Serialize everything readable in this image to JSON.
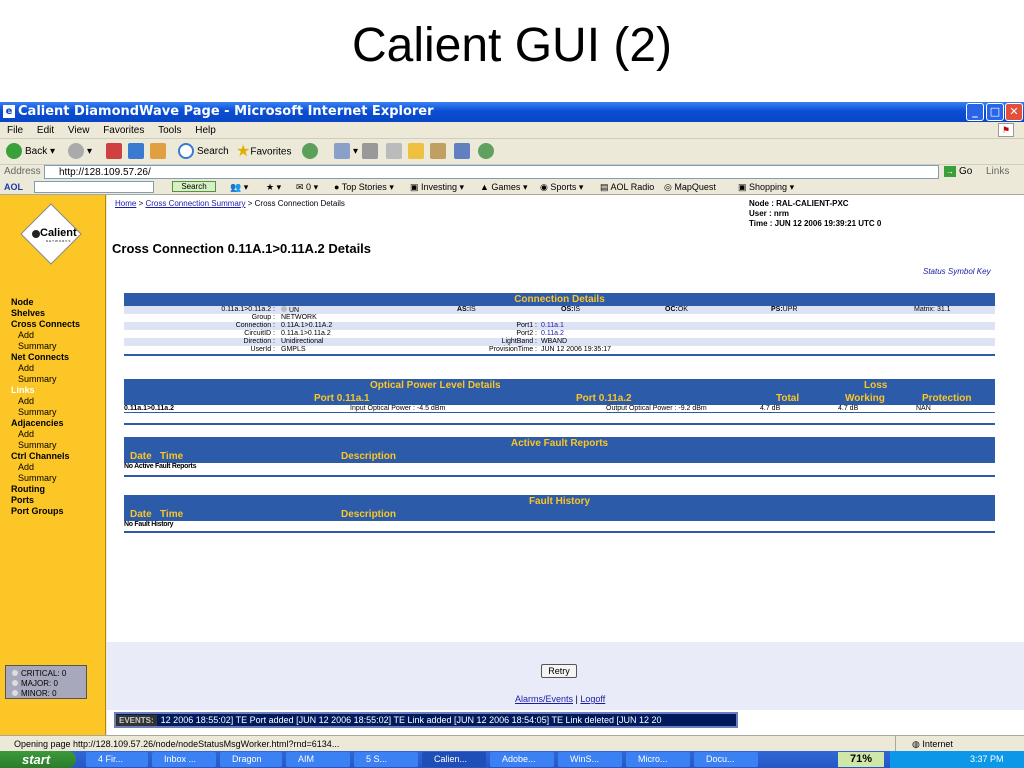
{
  "slide_title": "Calient GUI (2)",
  "window": {
    "title": "Calient DiamondWave Page - Microsoft Internet Explorer",
    "minimize": "_",
    "maximize": "□",
    "close": "✕"
  },
  "menu": [
    "File",
    "Edit",
    "View",
    "Favorites",
    "Tools",
    "Help"
  ],
  "toolbar": {
    "back": "Back",
    "search": "Search",
    "favorites": "Favorites"
  },
  "address": {
    "label": "Address",
    "url": "http://128.109.57.26/",
    "go": "Go",
    "links": "Links"
  },
  "aol": {
    "label": "AOL",
    "search_button": "Search",
    "mail_count": "0",
    "items": [
      "Top Stories",
      "Investing",
      "Games",
      "Sports",
      "AOL Radio",
      "MapQuest",
      "Shopping"
    ]
  },
  "sidebar": {
    "logo": "Calient",
    "logo_sub": "NETWORKS",
    "legend": [
      "CRITICAL: 0",
      "MAJOR: 0",
      "MINOR: 0"
    ]
  },
  "breadcrumb": {
    "home": "Home",
    "sep1": " > ",
    "summary": "Cross Connection Summary",
    "current": " > Cross Connection Details"
  },
  "node_info": {
    "node": "Node : RAL-CALIENT-PXC",
    "user": "User : nrm",
    "time": "Time : JUN 12 2006 19:39:21 UTC 0"
  },
  "page_title": "Cross Connection 0.11A.1>0.11A.2 Details",
  "status_symbol_key": "Status Symbol Key",
  "connection_details": {
    "header": "Connection Details",
    "name": "0.11a.1>0.11a.2 :",
    "name_status": "UN",
    "as_label": "AS:",
    "as_value": "IS",
    "os_label": "OS:",
    "os_value": "IS",
    "oc_label": "OC:",
    "oc_value": "OK",
    "ps_label": "PS:",
    "ps_value": "UPR",
    "matrix_label": "Matrix:",
    "matrix_value": "31.1",
    "group_label": "Group :",
    "group_value": "NETWORK",
    "connection_label": "Connection :",
    "connection_value": "0.11A.1>0.11A.2",
    "circuitid_label": "CircuitID :",
    "circuitid_value": "0.11a.1>0.11a.2",
    "direction_label": "Direction :",
    "direction_value": "Unidirectional",
    "userid_label": "UserId :",
    "userid_value": "GMPLS",
    "port1_label": "Port1 :",
    "port1_value": "0.11a.1",
    "port2_label": "Port2 :",
    "port2_value": "0.11a.2",
    "lightband_label": "LightBand :",
    "lightband_value": "WBAND",
    "provision_label": "ProvisionTime :",
    "provision_value": "JUN 12 2006 19:35:17"
  },
  "optical_power": {
    "header": "Optical Power Level Details",
    "loss": "Loss",
    "col_port1": "Port 0.11a.1",
    "col_port2": "Port 0.11a.2",
    "col_total": "Total",
    "col_working": "Working",
    "col_protection": "Protection",
    "row_name": "0.11a.1>0.11a.2",
    "input": "Input Optical Power : -4.5 dBm",
    "output": "Output Optical Power : -9.2 dBm",
    "total": "4.7 dB",
    "working": "4.7 dB",
    "protection": "NAN"
  },
  "active_faults": {
    "header": "Active Fault Reports",
    "col_date": "Date",
    "col_time": "Time",
    "col_desc": "Description",
    "empty": "No Active Fault Reports"
  },
  "fault_history": {
    "header": "Fault History",
    "col_date": "Date",
    "col_time": "Time",
    "col_desc": "Description",
    "empty": "No Fault History"
  },
  "retry": "Retry",
  "footer_links": {
    "alarms": "Alarms/Events",
    "sep": " | ",
    "logoff": "Logoff"
  },
  "events": {
    "label": "EVENTS:",
    "text": "12 2006 18:55:02] TE Port added    [JUN 12 2006 18:55:02] TE Link added    [JUN 12 2006 18:54:05] TE Link deleted    [JUN 12 20"
  },
  "status_bar": {
    "text": "Opening page http://128.109.57.26/node/nodeStatusMsgWorker.html?rnd=6134...",
    "zone": "Internet"
  },
  "taskbar": {
    "start": "start",
    "tasks": [
      "4 Fir...",
      "Inbox ...",
      "Dragon",
      "AIM",
      "5 S...",
      "Calien...",
      "Adobe...",
      "WinS...",
      "Micro...",
      "Docu..."
    ],
    "battery": "71%",
    "clock": "3:37 PM"
  },
  "colors": {
    "accent_blue": "#2c5baa",
    "sidebar_yellow": "#fcc626",
    "header_text": "#fcc626"
  }
}
